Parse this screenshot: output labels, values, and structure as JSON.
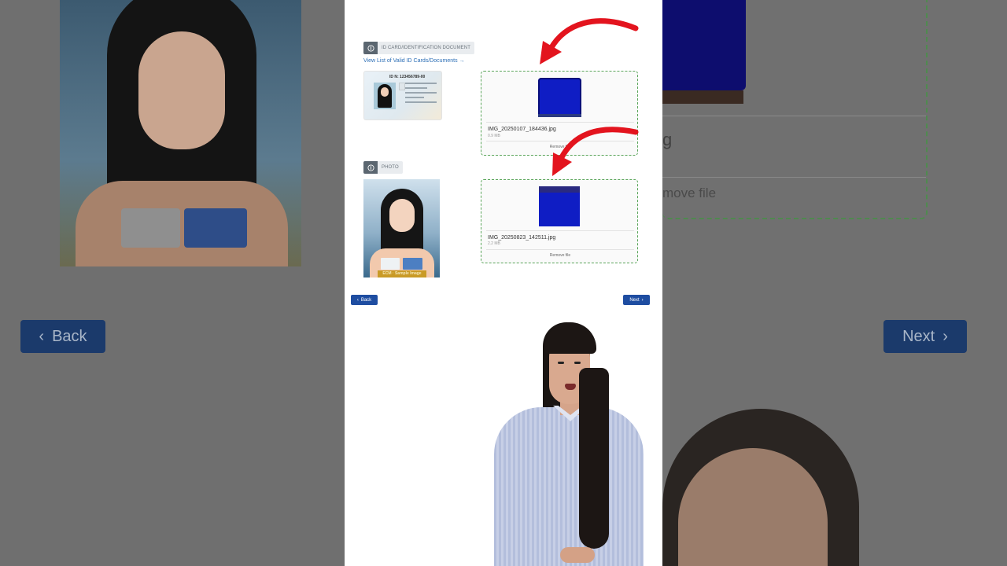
{
  "background": {
    "back_label": "Back",
    "next_label": "Next",
    "remove_file_fragment": "move file",
    "partial_char": "g"
  },
  "form": {
    "id_section": {
      "label": "ID CARD/IDENTIFICATION DOCUMENT",
      "link_text": "View List of Valid ID Cards/Documents →",
      "sample_id_number": "ID N: 123456789-00",
      "upload": {
        "file_name": "IMG_20250107_184436.jpg",
        "file_size": "0.9 MB",
        "remove_label": "Remove file"
      }
    },
    "photo_section": {
      "label": "PHOTO",
      "sample_banner": "ECM · Sample Image",
      "upload": {
        "file_name": "IMG_20250823_142511.jpg",
        "file_size": "2.2 MB",
        "remove_label": "Remove file"
      }
    },
    "nav": {
      "back_label": "Back",
      "next_label": "Next"
    }
  },
  "colors": {
    "accent_button": "#1e4da1",
    "link": "#2d6fb6",
    "dropzone_border": "#5aa55a",
    "annotation_arrow": "#e3141e",
    "uploaded_thumb": "#0f1dc4"
  },
  "icons": {
    "section_icon": "fingerprint-icon",
    "back_icon": "chevron-left-icon",
    "next_icon": "chevron-right-icon"
  }
}
